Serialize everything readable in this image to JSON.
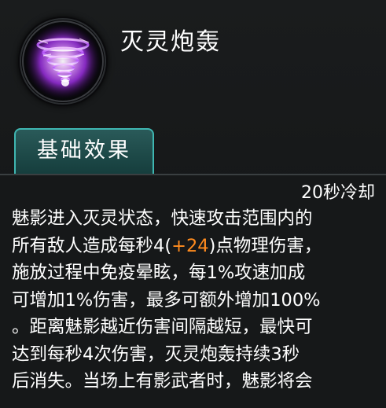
{
  "skill": {
    "name": "灭灵炮轰",
    "icon": "purple-vortex-icon"
  },
  "tabs": [
    {
      "label": "基础效果",
      "active": true
    }
  ],
  "cooldown": "20秒冷却",
  "description": {
    "line1": "魅影进入灭灵状态，快速攻击范围内的",
    "line2_pre": "所有敌人造成每秒4(",
    "line2_bonus": "+24",
    "line2_post": ")点物理伤害，",
    "line3": "施放过程中免疫晕眩，每1%攻速加成",
    "line4": "可增加1%伤害，最多可额外增加100%",
    "line5": "。距离魅影越近伤害间隔越短，最快可",
    "line6": "达到每秒4次伤害，灭灵炮轰持续3秒",
    "line7": "后消失。当场上有影武者时，魅影将会"
  },
  "colors": {
    "accent": "#3fb6b1",
    "bonus": "#ff8b1e",
    "text": "#ffffff"
  }
}
